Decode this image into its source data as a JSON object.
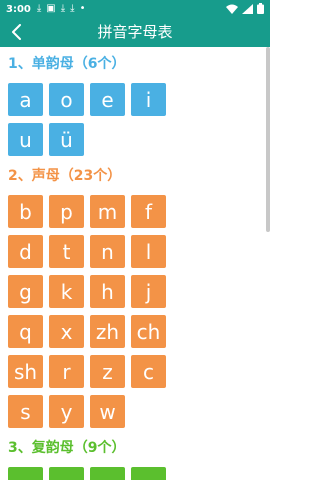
{
  "status": {
    "time": "3:00",
    "notifications": [
      "download-icon",
      "photo-icon",
      "download-icon",
      "download-icon",
      "dot-icon"
    ]
  },
  "header": {
    "title": "拼音字母表"
  },
  "sections": [
    {
      "title": "1、单韵母（6个）",
      "color": "#4ab0e3",
      "items": [
        "a",
        "o",
        "e",
        "i",
        "u",
        "ü"
      ]
    },
    {
      "title": "2、声母（23个）",
      "color": "#f39347",
      "items": [
        "b",
        "p",
        "m",
        "f",
        "d",
        "t",
        "n",
        "l",
        "g",
        "k",
        "h",
        "j",
        "q",
        "x",
        "zh",
        "ch",
        "sh",
        "r",
        "z",
        "c",
        "s",
        "y",
        "w"
      ]
    },
    {
      "title": "3、复韵母（9个）",
      "color": "#5bbf2e",
      "items": []
    }
  ]
}
